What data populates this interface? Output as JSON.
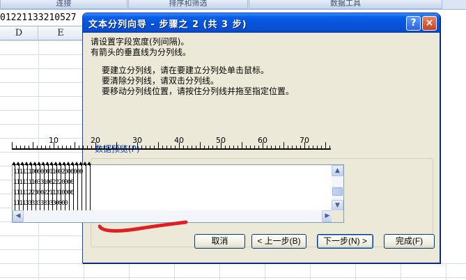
{
  "ribbon": {
    "groups": [
      "连接",
      "排序和筛选",
      "数据工具"
    ]
  },
  "formula_bar": {
    "value": "01221133210527"
  },
  "columns": [
    "D",
    "E"
  ],
  "dialog": {
    "title": "文本分列向导 - 步骤之 2 (共 3 步)",
    "help_icon": "?",
    "close_icon": "×",
    "instruction_1": "请设置字段宽度(列间隔)。",
    "instruction_2": "有箭头的垂直线为分列线。",
    "bullet_1": "要建立分列线，请在要建立分列处单击鼠标。",
    "bullet_2": "要清除分列线，请双击分列线。",
    "bullet_3": "要移动分列线位置，请按住分列线并拖至指定位置。",
    "preview_label": "数据预览(P)",
    "ruler_labels": [
      "10",
      "20",
      "30",
      "40",
      "50",
      "60",
      "70"
    ],
    "preview_rows": [
      "11111100000011002000000",
      "11111110331002220000",
      "11111223002211310000",
      "111133333333330000"
    ],
    "scroll_up_icon": "▲",
    "scroll_down_icon": "▼",
    "scroll_left_icon": "◀",
    "scroll_right_icon": "▶",
    "buttons": {
      "cancel": "取消",
      "back": "< 上一步(B)",
      "next": "下一步(N) >",
      "finish": "完成(F)"
    },
    "annotation_color": "#e02020"
  }
}
